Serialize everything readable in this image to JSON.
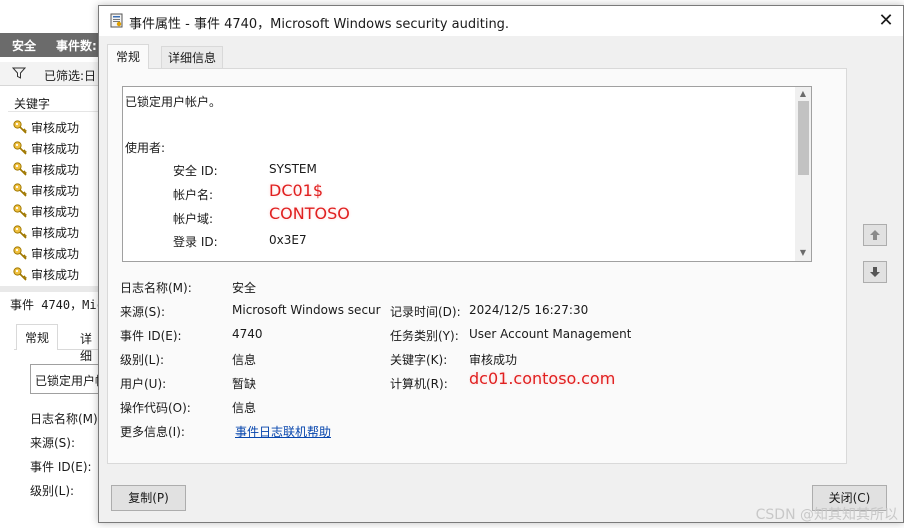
{
  "background": {
    "strip_label1": "安全",
    "strip_label2": "事件数:",
    "filter_label": "已筛选:日",
    "column_header": "关键字",
    "row_label": "审核成功",
    "row_count": 8,
    "lower_title": "事件 4740，Mic",
    "lower_tabs": {
      "general": "常规",
      "details": "详细"
    },
    "lower_desc_preview": "已锁定用户帐",
    "lower_fields": [
      "日志名称(M)",
      "来源(S):",
      "事件 ID(E):",
      "级别(L):"
    ]
  },
  "dialog": {
    "title": "事件属性 - 事件 4740，Microsoft Windows security auditing.",
    "close_glyph": "✕",
    "tabs": {
      "general": "常规",
      "details": "详细信息"
    },
    "description": {
      "heading": "已锁定用户帐户。",
      "subject_label": "使用者:",
      "fields": [
        {
          "label": "安全 ID:",
          "value": "SYSTEM"
        },
        {
          "label": "帐户名:",
          "value": "DC01$"
        },
        {
          "label": "帐户域:",
          "value": "CONTOSO"
        },
        {
          "label": "登录 ID:",
          "value": "0x3E7"
        }
      ]
    },
    "props": {
      "log_name": {
        "label": "日志名称(M):",
        "value": "安全"
      },
      "source": {
        "label": "来源(S):",
        "value": "Microsoft Windows secur"
      },
      "logged": {
        "label": "记录时间(D):",
        "value": "2024/12/5 16:27:30"
      },
      "event_id": {
        "label": "事件 ID(E):",
        "value": "4740"
      },
      "task_category": {
        "label": "任务类别(Y):",
        "value": "User Account Management"
      },
      "level": {
        "label": "级别(L):",
        "value": "信息"
      },
      "keywords": {
        "label": "关键字(K):",
        "value": "审核成功"
      },
      "user": {
        "label": "用户(U):",
        "value": "暂缺"
      },
      "computer": {
        "label": "计算机(R):",
        "value": "dc01.contoso.com"
      },
      "opcode": {
        "label": "操作代码(O):",
        "value": "信息"
      },
      "more_info": {
        "label": "更多信息(I):",
        "link": "事件日志联机帮助"
      }
    },
    "buttons": {
      "copy": "复制(P)",
      "close": "关闭(C)"
    },
    "nav_up_glyph": "🡅",
    "nav_down_glyph": "🡇"
  },
  "watermark": "CSDN @知其知其所以",
  "colors": {
    "highlight_red": "#e02020",
    "link_blue": "#0645ad"
  }
}
